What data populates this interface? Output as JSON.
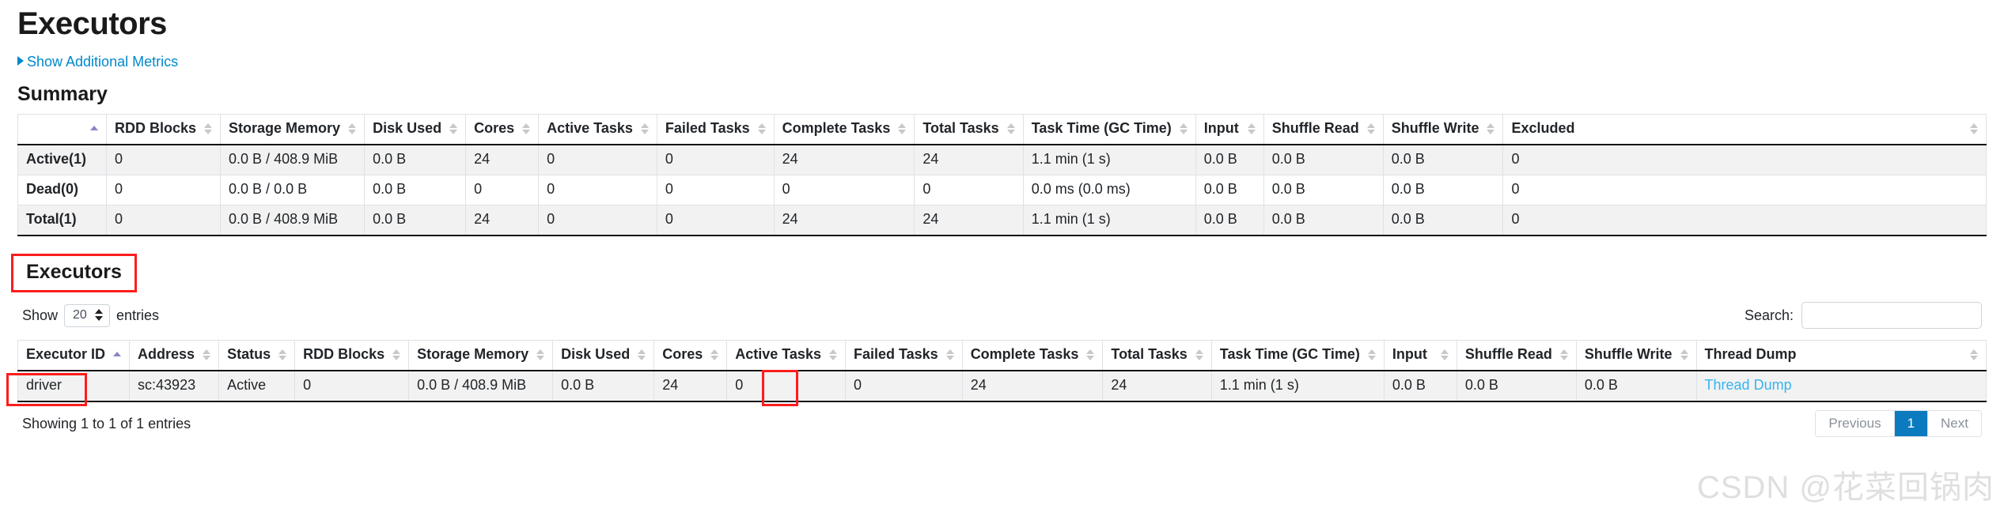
{
  "header": {
    "title": "Executors",
    "show_additional_metrics": "Show Additional Metrics"
  },
  "summary": {
    "title": "Summary",
    "columns": [
      "",
      "RDD Blocks",
      "Storage Memory",
      "Disk Used",
      "Cores",
      "Active Tasks",
      "Failed Tasks",
      "Complete Tasks",
      "Total Tasks",
      "Task Time (GC Time)",
      "Input",
      "Shuffle Read",
      "Shuffle Write",
      "Excluded"
    ],
    "rows": [
      {
        "label": "Active(1)",
        "rdd_blocks": "0",
        "storage_memory": "0.0 B / 408.9 MiB",
        "disk_used": "0.0 B",
        "cores": "24",
        "active_tasks": "0",
        "failed_tasks": "0",
        "complete_tasks": "24",
        "total_tasks": "24",
        "task_time": "1.1 min (1 s)",
        "input": "0.0 B",
        "shuffle_read": "0.0 B",
        "shuffle_write": "0.0 B",
        "excluded": "0"
      },
      {
        "label": "Dead(0)",
        "rdd_blocks": "0",
        "storage_memory": "0.0 B / 0.0 B",
        "disk_used": "0.0 B",
        "cores": "0",
        "active_tasks": "0",
        "failed_tasks": "0",
        "complete_tasks": "0",
        "total_tasks": "0",
        "task_time": "0.0 ms (0.0 ms)",
        "input": "0.0 B",
        "shuffle_read": "0.0 B",
        "shuffle_write": "0.0 B",
        "excluded": "0"
      },
      {
        "label": "Total(1)",
        "rdd_blocks": "0",
        "storage_memory": "0.0 B / 408.9 MiB",
        "disk_used": "0.0 B",
        "cores": "24",
        "active_tasks": "0",
        "failed_tasks": "0",
        "complete_tasks": "24",
        "total_tasks": "24",
        "task_time": "1.1 min (1 s)",
        "input": "0.0 B",
        "shuffle_read": "0.0 B",
        "shuffle_write": "0.0 B",
        "excluded": "0"
      }
    ]
  },
  "executors": {
    "title": "Executors",
    "controls": {
      "show_label": "Show",
      "entries_label": "entries",
      "page_length": "20",
      "search_label": "Search:",
      "search_value": "",
      "search_placeholder": ""
    },
    "columns": [
      "Executor ID",
      "Address",
      "Status",
      "RDD Blocks",
      "Storage Memory",
      "Disk Used",
      "Cores",
      "Active Tasks",
      "Failed Tasks",
      "Complete Tasks",
      "Total Tasks",
      "Task Time (GC Time)",
      "Input",
      "Shuffle Read",
      "Shuffle Write",
      "Thread Dump"
    ],
    "rows": [
      {
        "executor_id": "driver",
        "address": "sc:43923",
        "status": "Active",
        "rdd_blocks": "0",
        "storage_memory": "0.0 B / 408.9 MiB",
        "disk_used": "0.0 B",
        "cores": "24",
        "active_tasks": "0",
        "failed_tasks": "0",
        "complete_tasks": "24",
        "total_tasks": "24",
        "task_time": "1.1 min (1 s)",
        "input": "0.0 B",
        "shuffle_read": "0.0 B",
        "shuffle_write": "0.0 B",
        "thread_dump": "Thread Dump"
      }
    ],
    "footer": {
      "info": "Showing 1 to 1 of 1 entries",
      "previous": "Previous",
      "page_number": "1",
      "next": "Next"
    }
  },
  "watermark": "CSDN @花菜回锅肉",
  "colors": {
    "highlight": "#fc1d1d",
    "link": "#0088cc",
    "sort_active": "#8686c8",
    "page_active": "#0c7abf"
  }
}
